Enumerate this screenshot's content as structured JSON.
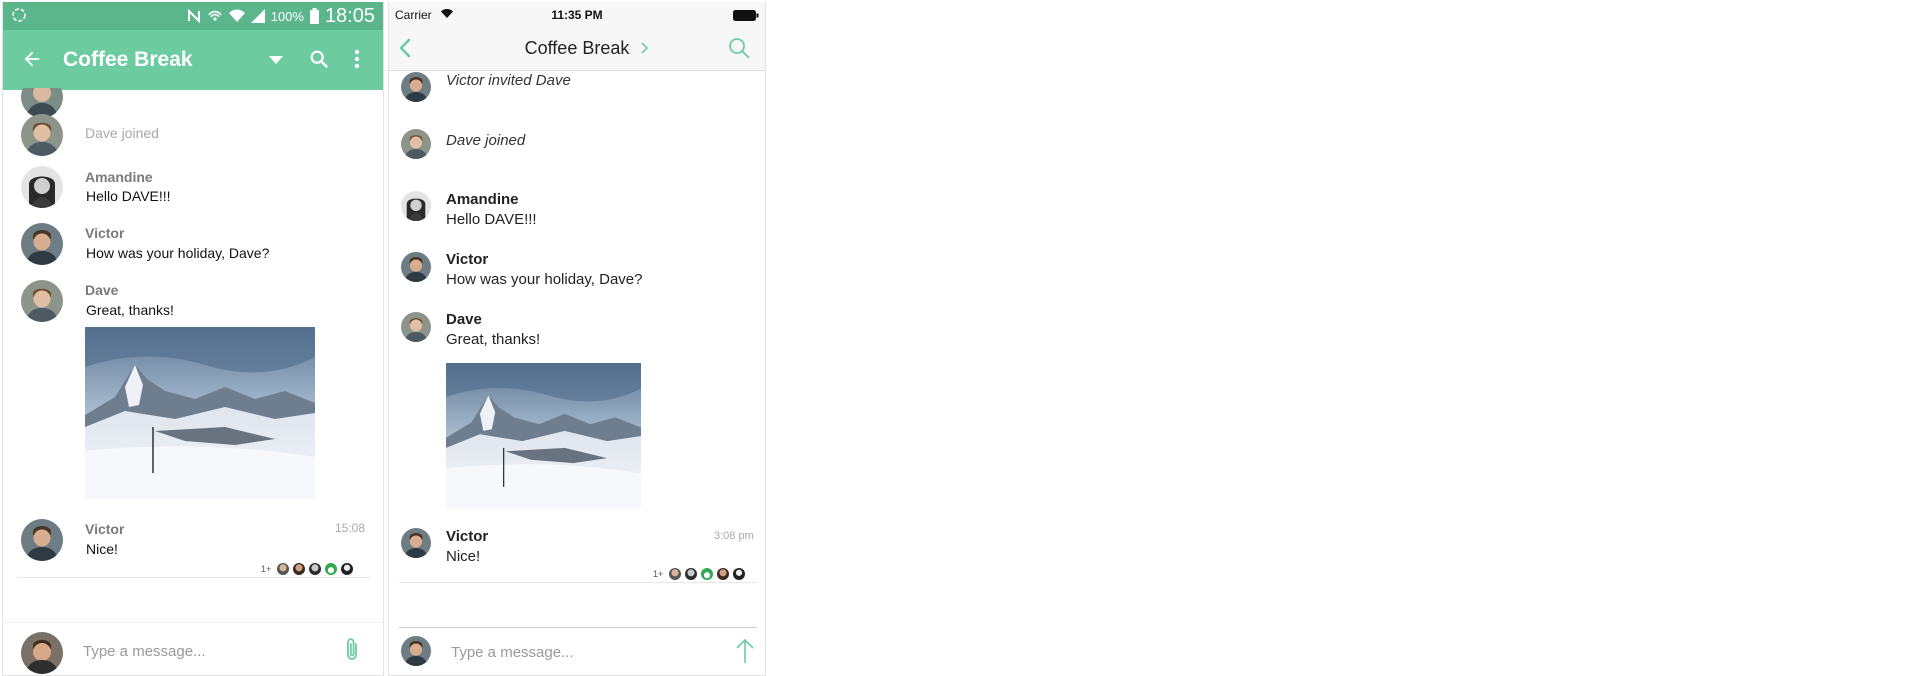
{
  "android": {
    "status": {
      "battery": "100%",
      "time": "18:05"
    },
    "toolbar": {
      "title": "Coffee Break"
    },
    "messages": {
      "dave_joined": "Dave joined",
      "amandine": {
        "name": "Amandine",
        "text": "Hello DAVE!!!"
      },
      "victor1": {
        "name": "Victor",
        "text": "How was your holiday, Dave?"
      },
      "dave": {
        "name": "Dave",
        "text": "Great, thanks!"
      },
      "victor2": {
        "name": "Victor",
        "text": "Nice!",
        "time": "15:08"
      }
    },
    "receipts": {
      "more": "1+"
    },
    "composer": {
      "placeholder": "Type a message..."
    }
  },
  "ios": {
    "status": {
      "carrier": "Carrier",
      "time": "11:35 PM"
    },
    "nav": {
      "title": "Coffee Break"
    },
    "messages": {
      "victor_invited": "Victor invited Dave",
      "dave_joined": "Dave joined",
      "amandine": {
        "name": "Amandine",
        "text": "Hello DAVE!!!"
      },
      "victor1": {
        "name": "Victor",
        "text": "How was your holiday, Dave?"
      },
      "dave": {
        "name": "Dave",
        "text": "Great, thanks!"
      },
      "victor2": {
        "name": "Victor",
        "text": "Nice!",
        "time": "3:08 pm"
      }
    },
    "receipts": {
      "more": "1+"
    },
    "composer": {
      "placeholder": "Type a message..."
    }
  },
  "theme": {
    "accent": "#6dcba0",
    "status_bar": "#5cb68c"
  },
  "icons": [
    "arrow-back-icon",
    "dropdown-icon",
    "search-icon",
    "more-vert-icon",
    "paperclip-icon",
    "chevron-left-icon",
    "chevron-right-icon",
    "send-arrow-icon",
    "wifi-icon",
    "battery-icon"
  ]
}
